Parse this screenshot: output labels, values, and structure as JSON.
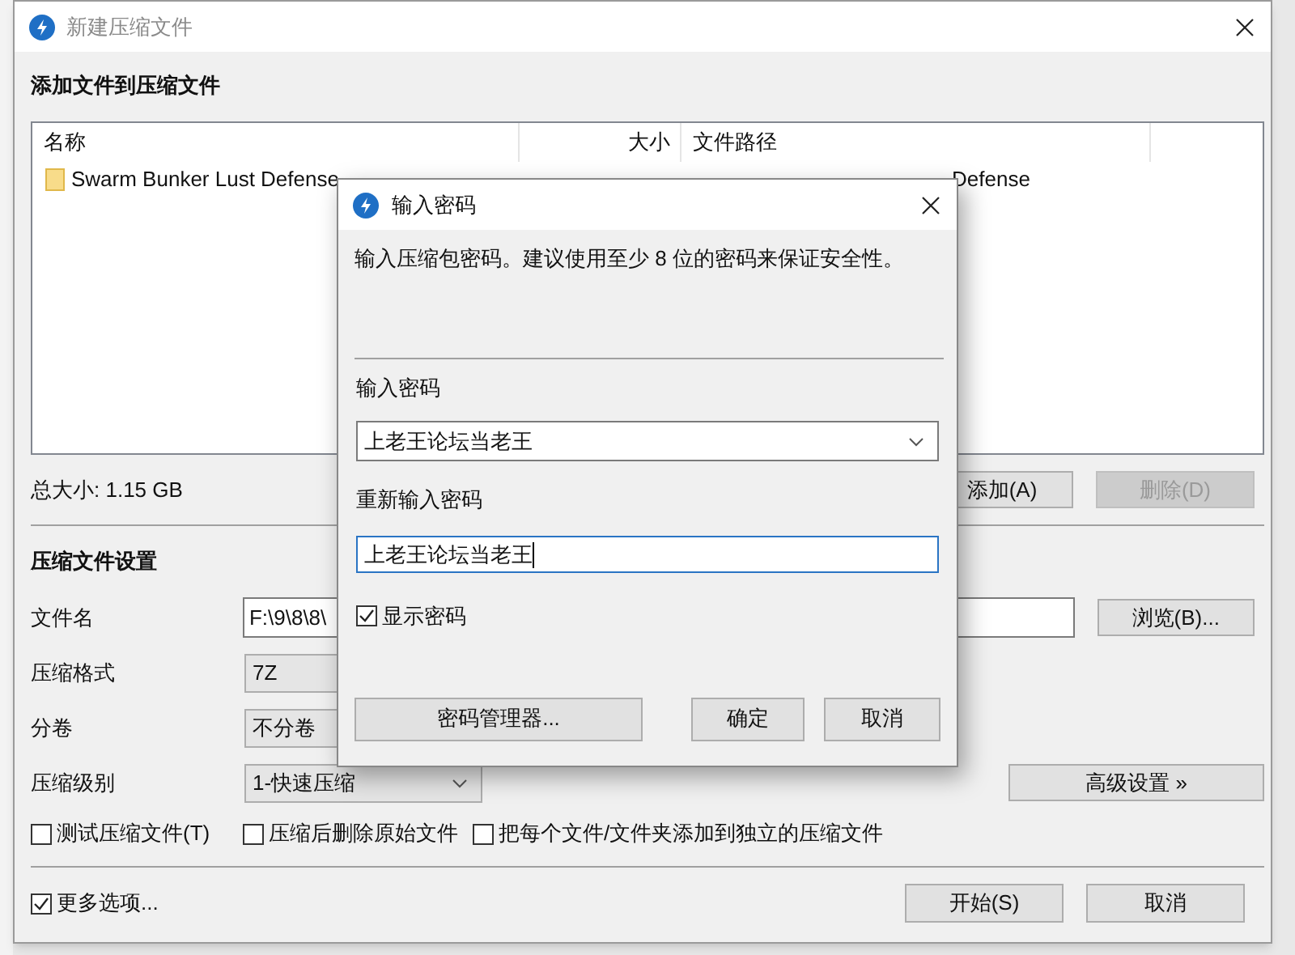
{
  "window": {
    "title": "新建压缩文件"
  },
  "files": {
    "heading": "添加文件到压缩文件",
    "columns": [
      "名称",
      "大小",
      "文件路径"
    ],
    "rows": [
      {
        "name": "Swarm Bunker Lust Defense",
        "path": "Defense"
      }
    ],
    "total": "总大小: 1.15 GB",
    "buttons": [
      {
        "label": "添加(A)",
        "disabled": false
      },
      {
        "label": "删除(D)",
        "disabled": true
      }
    ]
  },
  "settings": {
    "heading": "压缩文件设置",
    "fields": [
      {
        "kind": "text",
        "label": "文件名",
        "value": "F:\\9\\8\\8\\"
      },
      {
        "kind": "select",
        "label": "压缩格式",
        "value": "7Z"
      },
      {
        "kind": "select",
        "label": "分卷",
        "value": "不分卷"
      },
      {
        "kind": "dropdown",
        "label": "压缩级别",
        "value": "1-快速压缩"
      }
    ],
    "browse": "浏览(B)...",
    "advanced": "高级设置 »",
    "options": [
      {
        "label": "测试压缩文件(T)",
        "checked": false
      },
      {
        "label": "压缩后删除原始文件",
        "checked": false
      },
      {
        "label": "把每个文件/文件夹添加到独立的压缩文件",
        "checked": false
      }
    ]
  },
  "footer": {
    "more": {
      "label": "更多选项...",
      "checked": true
    },
    "buttons": [
      "开始(S)",
      "取消"
    ]
  },
  "dialog": {
    "title": "输入密码",
    "message": "输入压缩包密码。建议使用至少 8 位的密码来保证安全性。",
    "password_label": "输入密码",
    "password": "上老王论坛当老王",
    "confirm_label": "重新输入密码",
    "confirm": "上老王论坛当老王",
    "show": {
      "label": "显示密码",
      "checked": true
    },
    "manager": "密码管理器...",
    "buttons": [
      "确定",
      "取消"
    ]
  }
}
